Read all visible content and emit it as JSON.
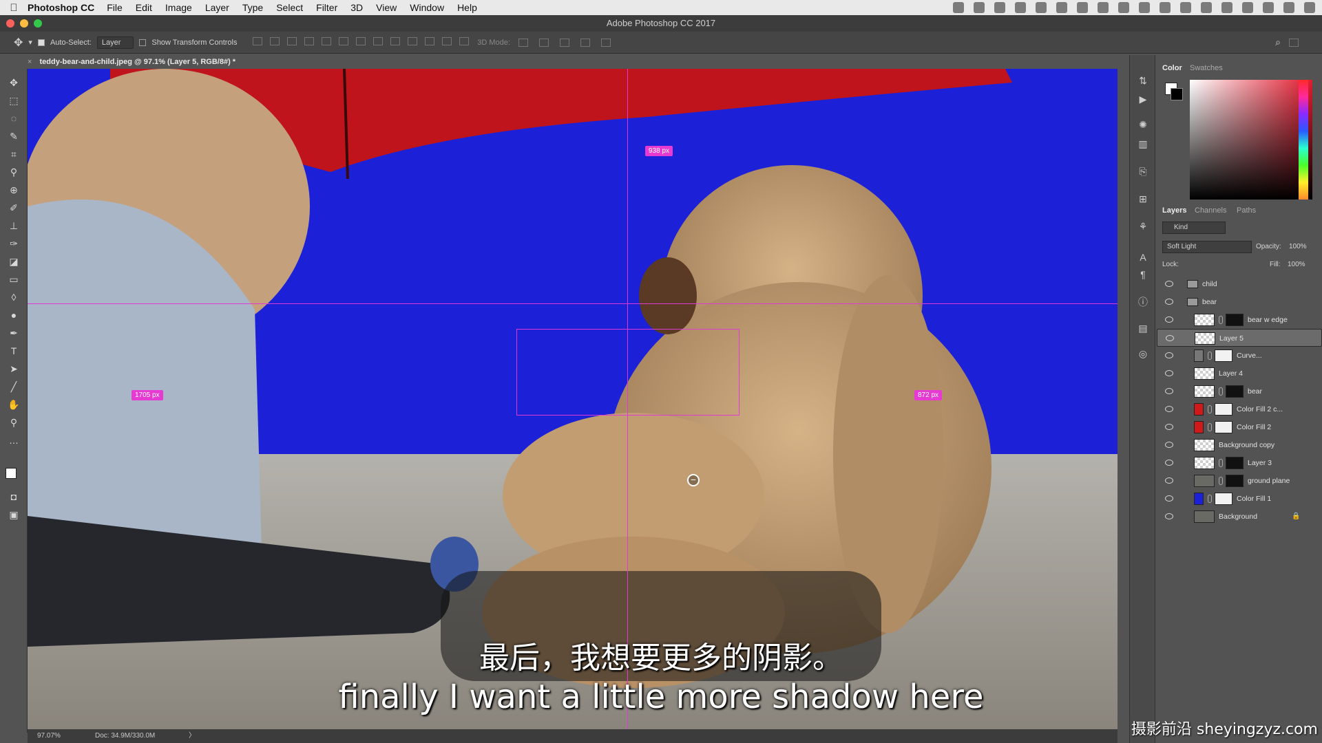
{
  "menubar": {
    "app": "Photoshop CC",
    "menus": [
      "File",
      "Edit",
      "Image",
      "Layer",
      "Type",
      "Select",
      "Filter",
      "3D",
      "View",
      "Window",
      "Help"
    ]
  },
  "window": {
    "title": "Adobe Photoshop CC 2017"
  },
  "options": {
    "auto_select_label": "Auto-Select:",
    "auto_select_value": "Layer",
    "transform_label": "Show Transform Controls",
    "mode_label": "3D Mode:"
  },
  "document": {
    "tab": "teddy-bear-and-child.jpeg @ 97.1% (Layer 5, RGB/8#) *"
  },
  "canvas": {
    "measure_top": "938 px",
    "measure_left": "1705 px",
    "measure_right": "872 px"
  },
  "statusbar": {
    "zoom": "97.07%",
    "doc": "Doc: 34.9M/330.0M",
    "arrow": "〉"
  },
  "color_panel": {
    "tabs": [
      "Color",
      "Swatches"
    ]
  },
  "layers_panel": {
    "tabs": [
      "Layers",
      "Channels",
      "Paths"
    ],
    "filter_label": "Kind",
    "blend_mode": "Soft Light",
    "opacity_label": "Opacity:",
    "opacity_value": "100%",
    "lock_label": "Lock:",
    "fill_label": "Fill:",
    "fill_value": "100%",
    "layers": [
      {
        "name": "child",
        "kind": "group-collapsed"
      },
      {
        "name": "bear",
        "kind": "group-open"
      },
      {
        "name": "bear w edge",
        "kind": "pixel-mask"
      },
      {
        "name": "Layer 5",
        "kind": "pixel-selected"
      },
      {
        "name": "Curve...",
        "kind": "adjustment"
      },
      {
        "name": "Layer 4",
        "kind": "pixel"
      },
      {
        "name": "bear",
        "kind": "pixel-mask"
      },
      {
        "name": "Color Fill 2 c...",
        "kind": "fill-red"
      },
      {
        "name": "Color Fill 2",
        "kind": "fill-red"
      },
      {
        "name": "Background copy",
        "kind": "pixel"
      },
      {
        "name": "Layer 3",
        "kind": "pixel-mask"
      },
      {
        "name": "ground plane",
        "kind": "pixel-mask-black"
      },
      {
        "name": "Color Fill 1",
        "kind": "fill-blue"
      },
      {
        "name": "Background",
        "kind": "locked"
      }
    ]
  },
  "subtitles": {
    "chinese": "最后，我想要更多的阴影。",
    "english": "finally I want a little more shadow here"
  },
  "watermark": "摄影前沿 sheyingzyz.com",
  "colors": {
    "canvas_blue": "#1c21d8",
    "guide": "#e03ad4",
    "umbrella_red": "#c0141c"
  }
}
